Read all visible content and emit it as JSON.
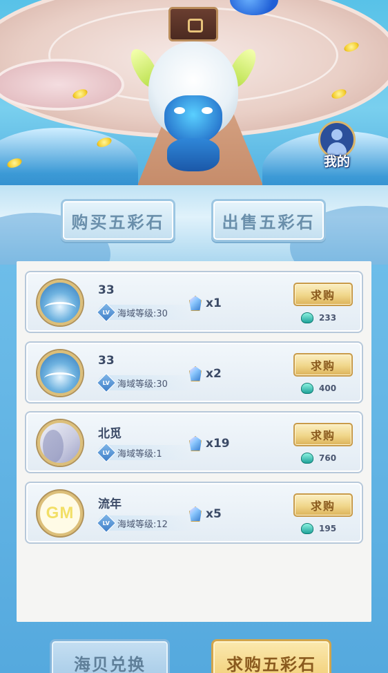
{
  "profile": {
    "label": "我的"
  },
  "tabs": [
    {
      "label": "购买五彩石",
      "active": false
    },
    {
      "label": "出售五彩石",
      "active": false
    }
  ],
  "listings": [
    {
      "name": "33",
      "level_text": "海域等级:30",
      "lv_badge": "LV",
      "quantity": "x1",
      "action": "求购",
      "price": "233",
      "avatar": "sea-avatar"
    },
    {
      "name": "33",
      "level_text": "海域等级:30",
      "lv_badge": "LV",
      "quantity": "x2",
      "action": "求购",
      "price": "400",
      "avatar": "sea-avatar"
    },
    {
      "name": "北觅",
      "level_text": "海域等级:1",
      "lv_badge": "LV",
      "quantity": "x19",
      "action": "求购",
      "price": "760",
      "avatar": "face-avatar"
    },
    {
      "name": "流年",
      "level_text": "海域等级:12",
      "lv_badge": "LV",
      "quantity": "x5",
      "action": "求购",
      "price": "195",
      "avatar": "gm-avatar",
      "avatar_text": "GM"
    }
  ],
  "bottom": {
    "shell_exchange": "海贝兑换",
    "request_stones": "求购五彩石"
  },
  "colors": {
    "gold_button": "#f0d68a",
    "blue_button": "#c3dff0",
    "panel": "#f5f5f3"
  }
}
